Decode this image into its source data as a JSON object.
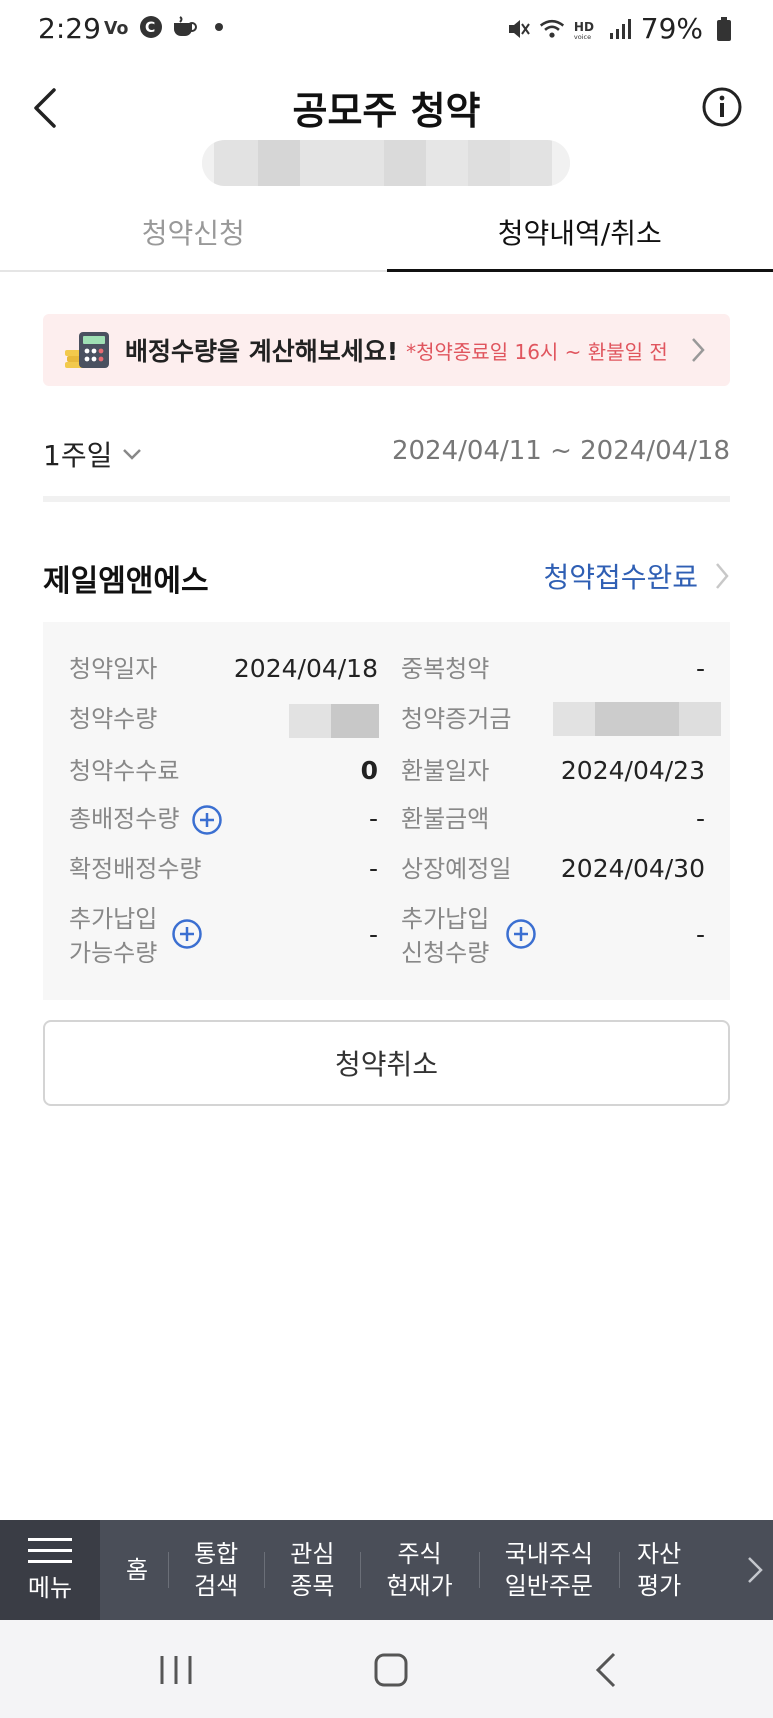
{
  "status_bar": {
    "time": "2:29",
    "battery": "79%",
    "left_icons": [
      "volte-icon",
      "c-icon",
      "coffee-icon",
      "dot-icon"
    ],
    "right_icons": [
      "mute-icon",
      "wifi-icon",
      "hd-voice-icon",
      "signal-icon",
      "battery-icon"
    ]
  },
  "header": {
    "title": "공모주 청약"
  },
  "tabs": [
    {
      "label": "청약신청",
      "active": false
    },
    {
      "label": "청약내역/취소",
      "active": true
    }
  ],
  "banner": {
    "main_text": "배정수량을 계산해보세요!",
    "sub_text": "*청약종료일 16시 ~ 환불일 전",
    "icon": "calculator-icon"
  },
  "period": {
    "selected": "1주일",
    "date_range": "2024/04/11 ~ 2024/04/18"
  },
  "subscription": {
    "company": "제일엠앤에스",
    "status": "청약접수완료",
    "rows": [
      {
        "l_label": "청약일자",
        "l_value": "2024/04/18",
        "r_label": "중복청약",
        "r_value": "-"
      },
      {
        "l_label": "청약수량",
        "l_value": "",
        "r_label": "청약증거금",
        "r_value": ""
      },
      {
        "l_label": "청약수수료",
        "l_value": "0",
        "r_label": "환불일자",
        "r_value": "2024/04/23"
      },
      {
        "l_label": "총배정수량",
        "l_value": "-",
        "r_label": "환불금액",
        "r_value": "-"
      },
      {
        "l_label": "확정배정수량",
        "l_value": "-",
        "r_label": "상장예정일",
        "r_value": "2024/04/30"
      },
      {
        "l_label_1": "추가납입",
        "l_label_2": "가능수량",
        "l_value": "-",
        "r_label_1": "추가납입",
        "r_label_2": "신청수량",
        "r_value": "-"
      }
    ]
  },
  "cancel_button": "청약취소",
  "bottom_menu": {
    "menu_label": "메뉴",
    "items": [
      "홈",
      "통합\n검색",
      "관심\n종목",
      "주식\n현재가",
      "국내주식\n일반주문",
      "자산\n평가"
    ]
  },
  "colors": {
    "accent_blue": "#2f5fb4",
    "banner_bg": "#fdeeee",
    "banner_red": "#e0555e",
    "menu_bg": "#4a4e58"
  }
}
